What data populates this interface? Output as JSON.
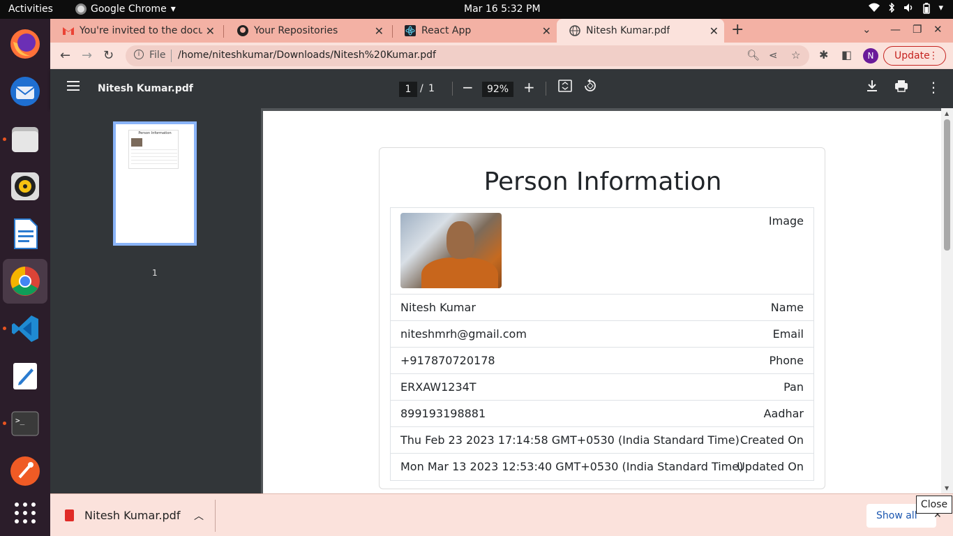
{
  "topbar": {
    "activities": "Activities",
    "app_name": "Google Chrome",
    "app_menu_arrow": "▾",
    "datetime": "Mar 16  5:32 PM"
  },
  "tabs": [
    {
      "title": "You're invited to the docu",
      "icon": "gmail-icon"
    },
    {
      "title": "Your Repositories",
      "icon": "github-icon"
    },
    {
      "title": "React App",
      "icon": "react-icon"
    },
    {
      "title": "Nitesh Kumar.pdf",
      "icon": "globe-icon",
      "active": true
    }
  ],
  "omnibox": {
    "scheme": "File",
    "url": "/home/niteshkumar/Downloads/Nitesh%20Kumar.pdf"
  },
  "profile": {
    "initial": "N"
  },
  "update_button": {
    "label": "Update"
  },
  "pdf": {
    "filename": "Nitesh Kumar.pdf",
    "current_page": "1",
    "page_sep": "/",
    "total_pages": "1",
    "zoom": "92%",
    "thumbnail_label": "1"
  },
  "document": {
    "title": "Person Information",
    "thumbnail_title": "Person Information",
    "rows": [
      {
        "label": "Image",
        "value": ""
      },
      {
        "label": "Name",
        "value": "Nitesh Kumar"
      },
      {
        "label": "Email",
        "value": "niteshmrh@gmail.com"
      },
      {
        "label": "Phone",
        "value": "+917870720178"
      },
      {
        "label": "Pan",
        "value": "ERXAW1234T"
      },
      {
        "label": "Aadhar",
        "value": "899193198881"
      },
      {
        "label": "Created On",
        "value": "Thu Feb 23 2023 17:14:58 GMT+0530 (India Standard Time)"
      },
      {
        "label": "Updated On",
        "value": "Mon Mar 13 2023 12:53:40 GMT+0530 (India Standard Time)"
      }
    ]
  },
  "download_shelf": {
    "filename": "Nitesh Kumar.pdf",
    "show_all": "Show all",
    "tooltip": "Close"
  },
  "colors": {
    "tabstrip": "#f3b1a4",
    "toolbar": "#fbe2dc",
    "pdf_toolbar": "#323639",
    "thumbnail_border": "#8ab4f8",
    "update_accent": "#c5221f"
  }
}
